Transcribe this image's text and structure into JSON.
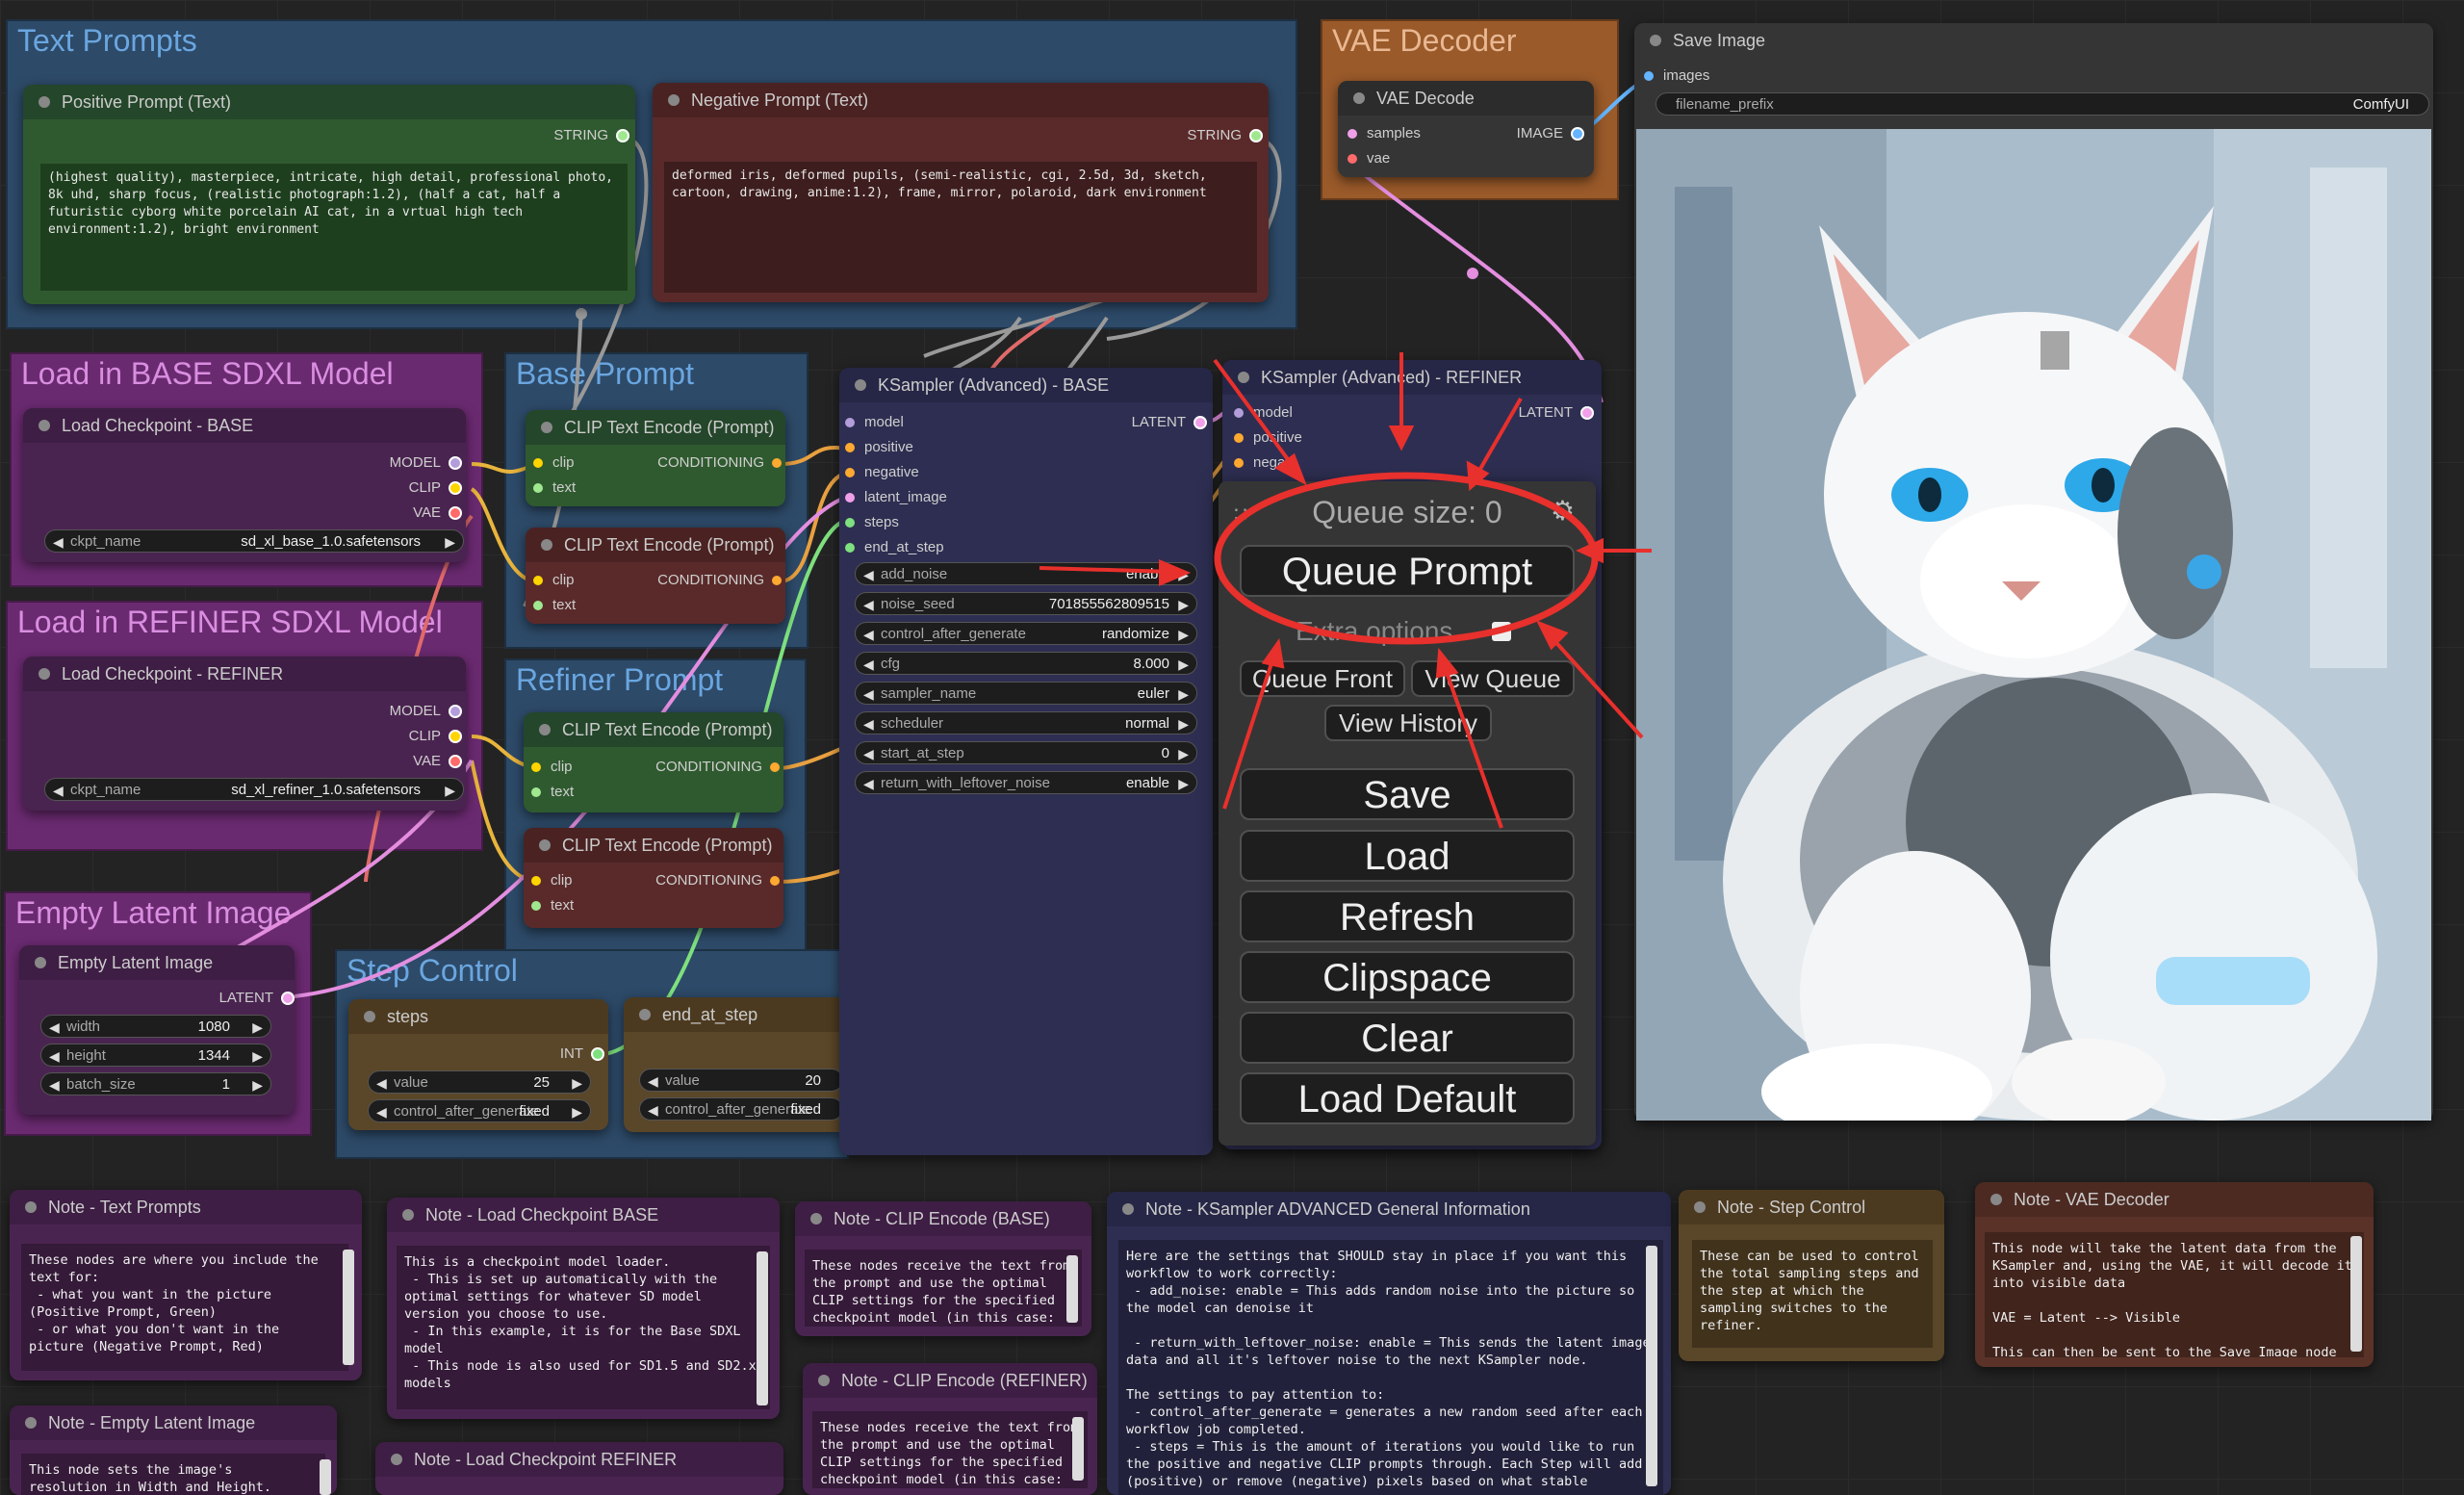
{
  "groups": {
    "text_prompts": "Text Prompts",
    "vae_decoder": "VAE Decoder",
    "base_model": "Load in BASE SDXL Model",
    "base_prompt": "Base Prompt",
    "refiner_model": "Load in REFINER SDXL Model",
    "refiner_prompt": "Refiner Prompt",
    "empty_latent": "Empty Latent Image",
    "step_control": "Step Control"
  },
  "positive_prompt": {
    "title": "Positive Prompt (Text)",
    "output": "STRING",
    "text": "(highest quality), masterpiece, intricate, high detail, professional photo, 8k uhd, sharp focus, (realistic photograph:1.2), (half a cat, half a futuristic cyborg white porcelain AI cat, in a vrtual high tech environment:1.2), bright environment"
  },
  "negative_prompt": {
    "title": "Negative Prompt (Text)",
    "output": "STRING",
    "text": "deformed iris, deformed pupils, (semi-realistic, cgi, 2.5d, 3d, sketch, cartoon, drawing, anime:1.2), frame, mirror, polaroid, dark environment"
  },
  "vae_decode": {
    "title": "VAE Decode",
    "in_samples": "samples",
    "in_vae": "vae",
    "output": "IMAGE"
  },
  "save_image": {
    "title": "Save Image",
    "in_images": "images",
    "prefix_label": "filename_prefix",
    "prefix_value": "ComfyUI"
  },
  "ckpt_base": {
    "title": "Load Checkpoint - BASE",
    "out_model": "MODEL",
    "out_clip": "CLIP",
    "out_vae": "VAE",
    "widget_label": "ckpt_name",
    "widget_value": "sd_xl_base_1.0.safetensors"
  },
  "ckpt_refiner": {
    "title": "Load Checkpoint - REFINER",
    "out_model": "MODEL",
    "out_clip": "CLIP",
    "out_vae": "VAE",
    "widget_label": "ckpt_name",
    "widget_value": "sd_xl_refiner_1.0.safetensors"
  },
  "clip_nodes": {
    "title": "CLIP Text Encode (Prompt)",
    "in_clip": "clip",
    "in_text": "text",
    "output": "CONDITIONING"
  },
  "empty_latent": {
    "title": "Empty Latent Image",
    "output": "LATENT",
    "width_label": "width",
    "width_value": "1080",
    "height_label": "height",
    "height_value": "1344",
    "batch_label": "batch_size",
    "batch_value": "1"
  },
  "steps_node": {
    "title": "steps",
    "output": "INT",
    "value_label": "value",
    "value_value": "25",
    "cag_label": "control_after_generate",
    "cag_value": "fixed"
  },
  "end_step_node": {
    "title": "end_at_step",
    "value_label": "value",
    "value_value": "20",
    "cag_label": "control_after_generate",
    "cag_value": "fixed"
  },
  "ksampler_base": {
    "title": "KSampler (Advanced) - BASE",
    "inputs": [
      "model",
      "positive",
      "negative",
      "latent_image",
      "steps",
      "end_at_step"
    ],
    "output": "LATENT",
    "widgets": [
      {
        "label": "add_noise",
        "value": "enable"
      },
      {
        "label": "noise_seed",
        "value": "701855562809515"
      },
      {
        "label": "control_after_generate",
        "value": "randomize"
      },
      {
        "label": "cfg",
        "value": "8.000"
      },
      {
        "label": "sampler_name",
        "value": "euler"
      },
      {
        "label": "scheduler",
        "value": "normal"
      },
      {
        "label": "start_at_step",
        "value": "0"
      },
      {
        "label": "return_with_leftover_noise",
        "value": "enable"
      }
    ]
  },
  "ksampler_refiner": {
    "title": "KSampler (Advanced) - REFINER",
    "inputs": [
      "model",
      "positive",
      "negati"
    ],
    "output": "LATENT"
  },
  "queue_panel": {
    "queue_size": "Queue size: 0",
    "queue_prompt": "Queue Prompt",
    "extra_options": "Extra options",
    "queue_front": "Queue Front",
    "view_queue": "View Queue",
    "view_history": "View History",
    "save": "Save",
    "load": "Load",
    "refresh": "Refresh",
    "clipspace": "Clipspace",
    "clear": "Clear",
    "load_default": "Load Default"
  },
  "notes": {
    "text_prompts": {
      "title": "Note - Text Prompts",
      "text": "These nodes are where you include the text for:\n - what you want in the picture (Positive Prompt, Green)\n - or what you don't want in the picture (Negative Prompt, Red)"
    },
    "ckpt_base": {
      "title": "Note - Load Checkpoint BASE",
      "text": "This is a checkpoint model loader.\n - This is set up automatically with the optimal settings for whatever SD model version you choose to use.\n - In this example, it is for the Base SDXL model\n - This node is also used for SD1.5 and SD2.x models"
    },
    "clip_base": {
      "title": "Note - CLIP Encode (BASE)",
      "text": "These nodes receive the text from the prompt and use the optimal CLIP settings for the specified checkpoint model (in this case:"
    },
    "clip_refiner": {
      "title": "Note - CLIP Encode (REFINER)",
      "text": "These nodes receive the text from the prompt and use the optimal CLIP settings for the specified checkpoint model (in this case:"
    },
    "ksampler": {
      "title": "Note - KSampler  ADVANCED General Information",
      "text": "Here are the settings that SHOULD stay in place if you want this workflow to work correctly:\n - add_noise: enable = This adds random noise into the picture so the model can denoise it\n\n - return_with_leftover_noise: enable = This sends the latent image data and all it's leftover noise to the next KSampler node.\n\nThe settings to pay attention to:\n - control_after_generate = generates a new random seed after each workflow job completed.\n - steps = This is the amount of iterations you would like to run the positive and negative CLIP prompts through. Each Step will add (positive) or remove (negative) pixels based on what stable"
    },
    "step_control": {
      "title": "Note - Step Control",
      "text": "These can be used to control the total sampling steps and the step at which the sampling switches to the refiner."
    },
    "vae": {
      "title": "Note - VAE Decoder",
      "text": "This node will take the latent data from the KSampler and, using the VAE, it will decode it into visible data\n\nVAE = Latent --> Visible\n\nThis can then be sent to the Save Image node to"
    },
    "empty_latent": {
      "title": "Note - Empty Latent Image",
      "text": "This node sets the image's resolution in Width and Height."
    },
    "ckpt_refiner": {
      "title": "Note - Load Checkpoint REFINER",
      "text": ""
    }
  },
  "icons": {
    "gear": "gear-icon",
    "drag": "drag-handle-icon"
  }
}
